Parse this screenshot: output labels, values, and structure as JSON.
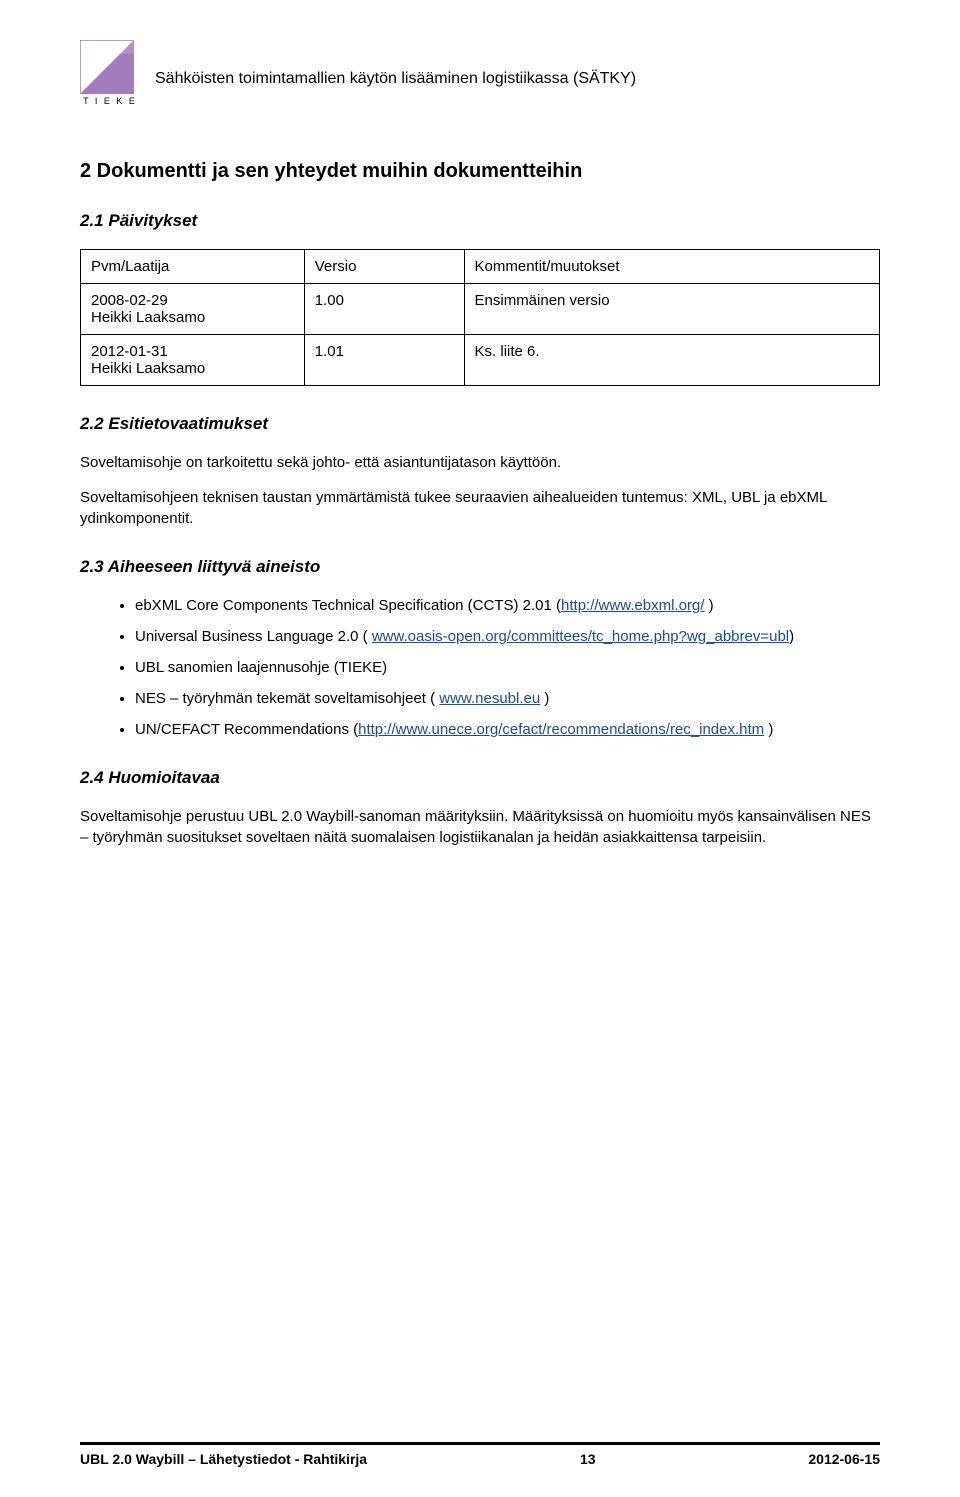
{
  "header": {
    "logo_label": "T I E K E",
    "doc_title": "Sähköisten toimintamallien käytön lisääminen logistiikassa (SÄTKY)"
  },
  "h1": "2   Dokumentti ja sen yhteydet muihin dokumentteihin",
  "s21": {
    "title": "2.1   Päivitykset",
    "th_a": "Pvm/Laatija",
    "th_b": "Versio",
    "th_c": "Kommentit/muutokset",
    "r1a": "2008-02-29\nHeikki Laaksamo",
    "r1b": "1.00",
    "r1c": "Ensimmäinen versio",
    "r2a": "2012-01-31\nHeikki Laaksamo",
    "r2b": "1.01",
    "r2c": "Ks. liite 6."
  },
  "s22": {
    "title": "2.2   Esitietovaatimukset",
    "p1": "Soveltamisohje on tarkoitettu sekä johto- että asiantuntijatason käyttöön.",
    "p2": "Soveltamisohjeen teknisen taustan ymmärtämistä tukee seuraavien aihealueiden tuntemus: XML, UBL ja ebXML ydinkomponentit."
  },
  "s23": {
    "title": "2.3   Aiheeseen liittyvä aineisto",
    "li1a": "ebXML Core Components Technical Specification (CCTS) 2.01 (",
    "li1link": "http://www.ebxml.org/",
    "li1b": " )",
    "li2a": "Universal Business Language 2.0 ( ",
    "li2link": "www.oasis-open.org/committees/tc_home.php?wg_abbrev=ubl",
    "li2b": ")",
    "li3": "UBL sanomien laajennusohje (TIEKE)",
    "li4a": "NES – työryhmän tekemät soveltamisohjeet ( ",
    "li4link": "www.nesubl.eu",
    "li4b": " )",
    "li5a": "UN/CEFACT Recommendations (",
    "li5link": "http://www.unece.org/cefact/recommendations/rec_index.htm",
    "li5b": " )"
  },
  "s24": {
    "title": "2.4   Huomioitavaa",
    "p1": "Soveltamisohje perustuu UBL 2.0 Waybill-sanoman määrityksiin. Määrityksissä on huomioitu myös kansainvälisen NES – työryhmän suositukset soveltaen näitä suomalaisen logistiikanalan ja heidän asiakkaittensa tarpeisiin."
  },
  "footer": {
    "left": "UBL 2.0 Waybill – Lähetystiedot - Rahtikirja",
    "center": "13",
    "right": "2012-06-15"
  }
}
